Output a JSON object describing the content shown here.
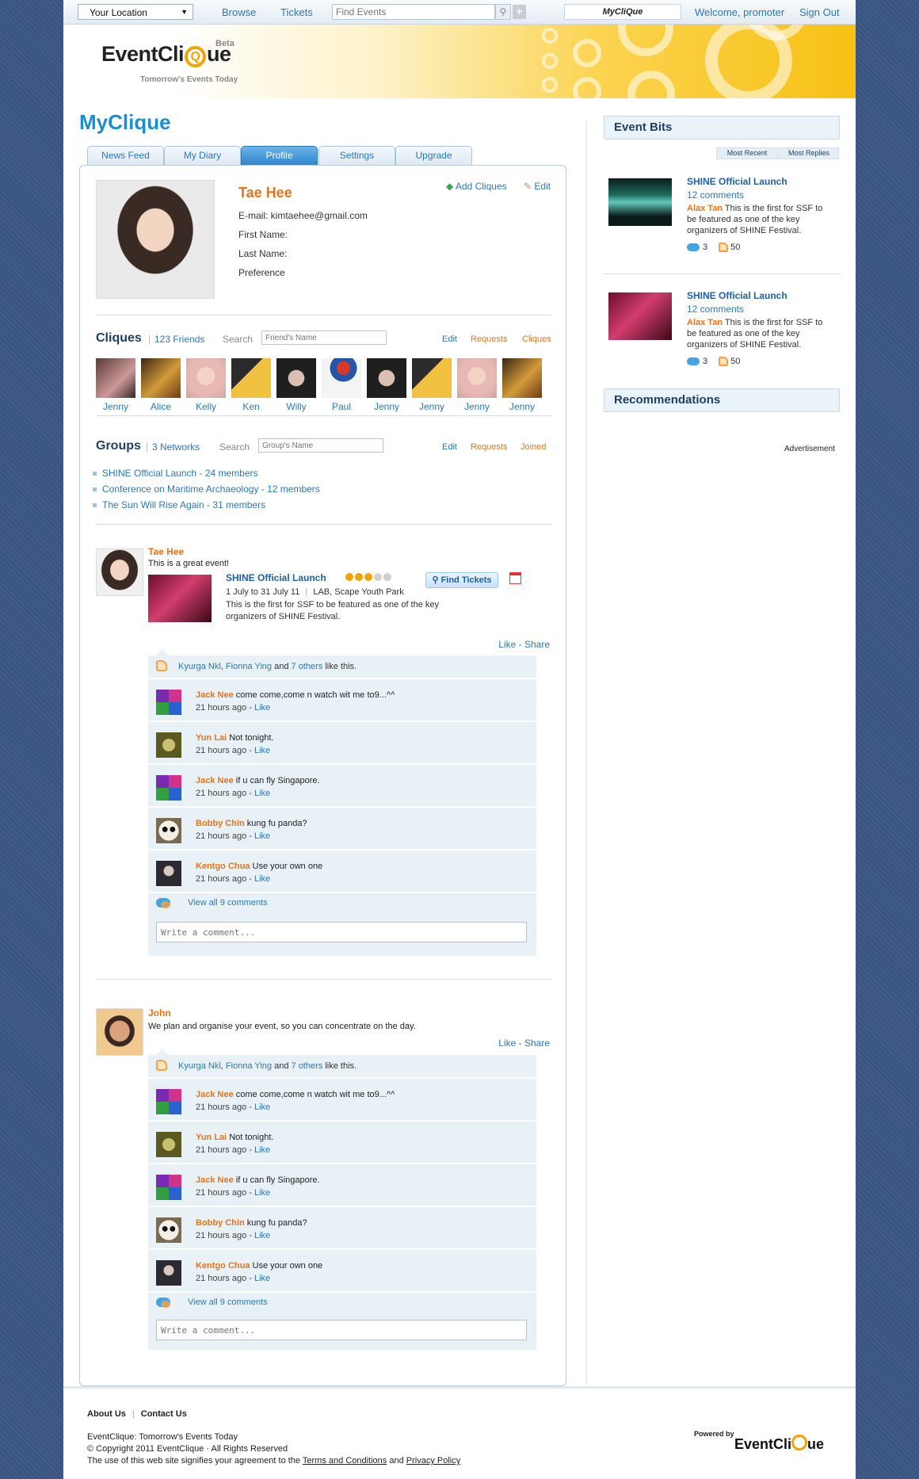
{
  "topbar": {
    "location": "Your Location",
    "nav": [
      "Browse",
      "Tickets"
    ],
    "search_placeholder": "Find Events",
    "myclique": "MyCliQue",
    "welcome": "Welcome, promoter",
    "signout": "Sign Out"
  },
  "brand": {
    "logo_pre": "EventCli",
    "logo_q": "Q",
    "logo_post": "ue",
    "beta": "Beta",
    "tagline": "Tomorrow's Events Today"
  },
  "page_title": "MyClique",
  "tabs": [
    "News Feed",
    "My Diary",
    "Profile",
    "Settings",
    "Upgrade"
  ],
  "active_tab": "Profile",
  "profile": {
    "name": "Tae Hee",
    "fields": [
      "E-mail: kimtaehee@gmail.com",
      "First Name:",
      "Last Name:",
      "Preference"
    ],
    "add_cliques": "Add Cliques",
    "edit": "Edit"
  },
  "cliques": {
    "title": "Cliques",
    "count": "123 Friends",
    "search_label": "Search",
    "search_placeholder": "Friend's Name",
    "links": [
      "Edit",
      "Requests",
      "Cliques"
    ],
    "friends": [
      "Jenny",
      "Alice",
      "Kelly",
      "Ken",
      "Willy",
      "Paul",
      "Jenny",
      "Jenny",
      "Jenny",
      "Jenny"
    ]
  },
  "groups": {
    "title": "Groups",
    "count": "3 Networks",
    "search_label": "Search",
    "search_placeholder": "Group's Name",
    "links": [
      "Edit",
      "Requests",
      "Joined"
    ],
    "items": [
      "SHINE Official Launch - 24 members",
      "Conference on Maritime Archaeology - 12 members",
      "The Sun Will Rise Again - 31 members"
    ]
  },
  "feed": [
    {
      "author": "Tae Hee",
      "message": "This is a great event!",
      "event": {
        "title": "SHINE Official Launch",
        "date": "1 July to 31 July 11",
        "venue": "LAB, Scape Youth Park",
        "desc": "This is the first for SSF to be featured as one of the key organizers of SHINE Festival.",
        "button": "Find Tickets"
      },
      "like": "Like",
      "share": "Share",
      "likes": {
        "a": "Kyurga Nkl",
        "b": "Fionna Ying",
        "and": "and",
        "others": "7 others",
        "tail": "like this."
      },
      "comments": [
        {
          "name": "Jack Nee",
          "text": "come come,come n watch wit me to9...^^",
          "time": "21 hours ago -",
          "like": "Like"
        },
        {
          "name": "Yun Lai",
          "text": "Not tonight.",
          "time": "21 hours ago -",
          "like": "Like"
        },
        {
          "name": "Jack Nee",
          "text": "if u can fly Singapore.",
          "time": "21 hours ago -",
          "like": "Like"
        },
        {
          "name": "Bobby Chin",
          "text": "kung fu panda?",
          "time": "21 hours ago -",
          "like": "Like"
        },
        {
          "name": "Kentgo Chua",
          "text": "Use your own one",
          "time": "21 hours ago -",
          "like": "Like"
        }
      ],
      "view_all": "View all 9 comments",
      "write_placeholder": "Write a comment..."
    },
    {
      "author": "John",
      "message": "We plan and organise your event, so you can concentrate on the day.",
      "like": "Like",
      "share": "Share",
      "likes": {
        "a": "Kyurga Nkl",
        "b": "Fionna Ying",
        "and": "and",
        "others": "7 others",
        "tail": "like this."
      },
      "comments": [
        {
          "name": "Jack Nee",
          "text": "come come,come n watch wit me to9...^^",
          "time": "21 hours ago -",
          "like": "Like"
        },
        {
          "name": "Yun Lai",
          "text": "Not tonight.",
          "time": "21 hours ago -",
          "like": "Like"
        },
        {
          "name": "Jack Nee",
          "text": "if u can fly Singapore.",
          "time": "21 hours ago -",
          "like": "Like"
        },
        {
          "name": "Bobby Chin",
          "text": "kung fu panda?",
          "time": "21 hours ago -",
          "like": "Like"
        },
        {
          "name": "Kentgo Chua",
          "text": "Use your own one",
          "time": "21 hours ago -",
          "like": "Like"
        }
      ],
      "view_all": "View all 9 comments",
      "write_placeholder": "Write a comment..."
    }
  ],
  "sidebar": {
    "event_bits_title": "Event Bits",
    "sort": [
      "Most Recent",
      "Most Replies"
    ],
    "bits": [
      {
        "title": "SHINE Official Launch",
        "comments": "12 comments",
        "author": "Alax Tan",
        "text": "This is the first for SSF to be featured as one of the key organizers of SHINE Festival.",
        "replies": "3",
        "likes": "50"
      },
      {
        "title": "SHINE Official Launch",
        "comments": "12 comments",
        "author": "Alax Tan",
        "text": "This is the first for SSF to be featured as one of the key organizers of SHINE Festival.",
        "replies": "3",
        "likes": "50"
      }
    ],
    "recommendations_title": "Recommendations",
    "advertisement": "Advertisement"
  },
  "footer": {
    "links": [
      "About Us",
      "Contact Us"
    ],
    "line1": "EventClique: Tomorrow's Events Today",
    "line2": "© Copyright 2011 EventClique · All Rights Reserved",
    "line3_pre": "The use of this web site signifies your agreement to the",
    "terms": "Terms and Conditions",
    "and": "and",
    "privacy": "Privacy Policy",
    "powered_by": "Powered by",
    "powered_logo_pre": "EventCli",
    "powered_logo_post": "ue"
  },
  "colors": {
    "brand_blue": "#1a8ecf",
    "accent_orange": "#e8741a",
    "link_blue": "#2a78b8",
    "background": "#3b5583",
    "banner_yellow": "#f7c114"
  }
}
